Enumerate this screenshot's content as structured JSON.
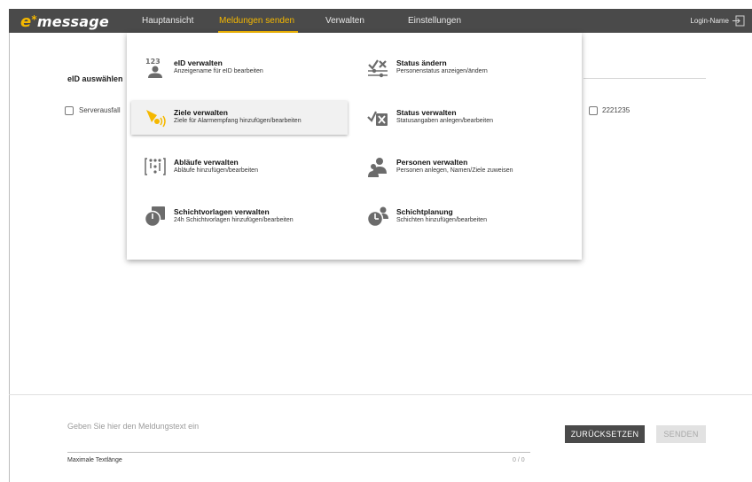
{
  "app": {
    "logo_e": "e",
    "logo_star": "*",
    "logo_rest": "message"
  },
  "nav": {
    "items": [
      "Hauptansicht",
      "Meldungen senden",
      "Verwalten",
      "Einstellungen"
    ],
    "active_index": 1,
    "login": "Login-Name"
  },
  "page": {
    "eid_label": "eID auswählen",
    "checkboxes": [
      "Serverausfall",
      "2221235"
    ]
  },
  "menu": {
    "items": [
      {
        "title": "eID verwalten",
        "subtitle": "Anzeigename für eID bearbeiten",
        "icon": "eid-icon",
        "badge": "123"
      },
      {
        "title": "Status ändern",
        "subtitle": "Personenstatus anzeigen/ändern",
        "icon": "status-change-icon"
      },
      {
        "title": "Ziele verwalten",
        "subtitle": "Ziele für Alarmempfang hinzufügen/bearbeiten",
        "icon": "targets-icon"
      },
      {
        "title": "Status verwalten",
        "subtitle": "Statusangaben anlegen/bearbeiten",
        "icon": "status-manage-icon"
      },
      {
        "title": "Abläufe verwalten",
        "subtitle": "Abläufe hinzufügen/bearbeiten",
        "icon": "workflow-icon"
      },
      {
        "title": "Personen verwalten",
        "subtitle": "Personen anlegen, Namen/Ziele zuweisen",
        "icon": "persons-icon"
      },
      {
        "title": "Schichtvorlagen verwalten",
        "subtitle": "24h Schichtvorlagen hinzufügen/bearbeiten",
        "icon": "shift-template-icon"
      },
      {
        "title": "Schichtplanung",
        "subtitle": "Schichten hinzufügen/bearbeiten",
        "icon": "shift-planning-icon"
      }
    ],
    "hovered_index": 2
  },
  "compose": {
    "placeholder": "Geben Sie hier den Meldungstext ein",
    "value": "",
    "maxlen_label": "Maximale Textlänge",
    "counter": "0 / 0",
    "reset_label": "ZURÜCKSETZEN",
    "send_label": "SENDEN"
  },
  "colors": {
    "topbar": "#4a4a4a",
    "accent": "#f5b800",
    "icon_gray": "#6b6b6b"
  }
}
